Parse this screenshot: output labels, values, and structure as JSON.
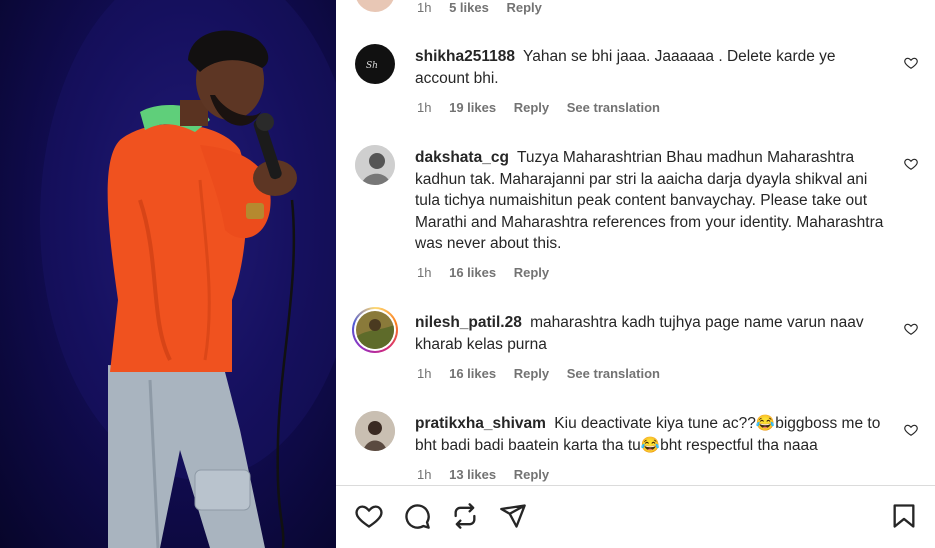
{
  "top_partial": {
    "time": "1h",
    "likes": "5 likes",
    "reply": "Reply"
  },
  "comments": [
    {
      "username": "shikha251188",
      "text": "Yahan se bhi jaaa. Jaaaaaa . Delete karde ye account bhi.",
      "time": "1h",
      "likes": "19 likes",
      "reply": "Reply",
      "see_translation": "See translation"
    },
    {
      "username": "dakshata_cg",
      "text": "Tuzya Maharashtrian Bhau madhun Maharashtra kadhun tak. Maharajanni par stri la aaicha darja dyayla shikval ani tula tichya numaishitun peak content banvaychay. Please take out Marathi and Maharashtra references from your identity. Maharashtra was never about this.",
      "time": "1h",
      "likes": "16 likes",
      "reply": "Reply"
    },
    {
      "username": "nilesh_patil.28",
      "text": "maharashtra kadh tujhya page name varun naav kharab kelas purna",
      "time": "1h",
      "likes": "16 likes",
      "reply": "Reply",
      "see_translation": "See translation"
    },
    {
      "username": "pratikxha_shivam",
      "text": "Kiu deactivate kiya tune ac??😂biggboss me to bht badi badi baatein karta tha tu😂bht respectful tha naaa",
      "time": "1h",
      "likes": "13 likes",
      "reply": "Reply"
    }
  ],
  "actions": {
    "like": "heart-icon",
    "comment": "comment-icon",
    "repost": "repost-icon",
    "share": "share-icon",
    "save": "bookmark-icon"
  }
}
